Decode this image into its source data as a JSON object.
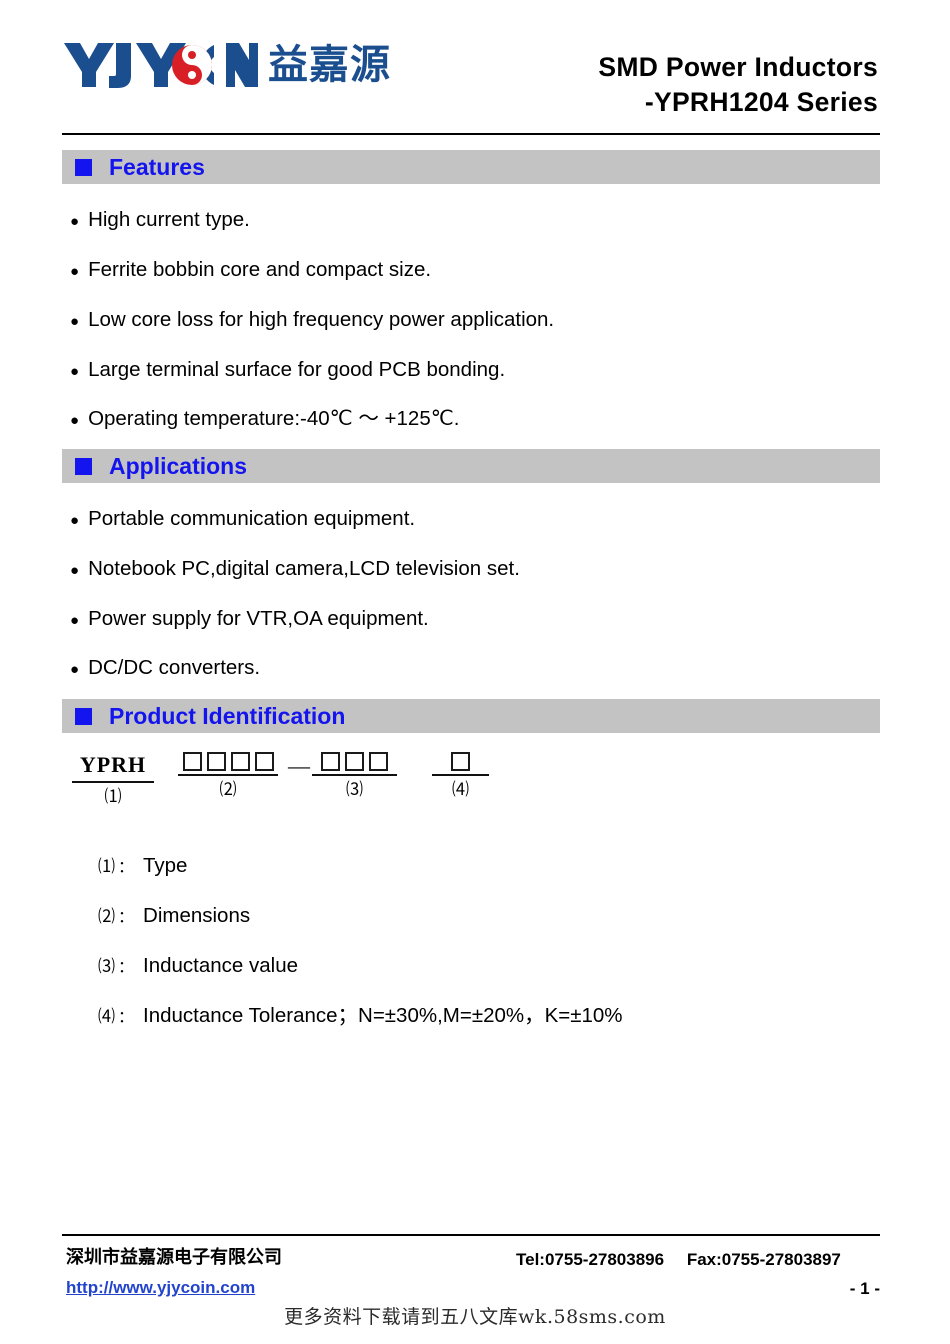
{
  "header": {
    "logo_text_cn": "益嘉源",
    "logo_brand": "YJYCOIN",
    "title_line1": "SMD Power Inductors",
    "title_line2": "-YPRH1204 Series"
  },
  "colors": {
    "section_bar_bg": "#c3c3c3",
    "section_accent": "#1414ee",
    "logo_blue": "#1b4e8f",
    "logo_red": "#d81f26",
    "link_blue": "#2244cc"
  },
  "sections": [
    {
      "title": "Features"
    },
    {
      "title": "Applications"
    },
    {
      "title": "Product Identification"
    }
  ],
  "features": [
    "High current type.",
    "Ferrite bobbin core and compact size.",
    "Low core loss for high frequency power application.",
    "Large terminal surface for good PCB bonding.",
    "Operating temperature:-40℃ ～ +125℃."
  ],
  "applications": [
    "Portable communication equipment.",
    "Notebook PC,digital camera,LCD television set.",
    "Power supply for VTR,OA equipment.",
    "DC/DC converters."
  ],
  "bullet_glyph": "●",
  "part_number": {
    "groups": [
      {
        "code": "YPRH",
        "boxes": 0,
        "label": "⑴"
      },
      {
        "code": "",
        "boxes": 4,
        "label": "⑵"
      },
      {
        "code": "",
        "boxes": 3,
        "label": "⑶"
      },
      {
        "code": "",
        "boxes": 1,
        "label": "⑷"
      }
    ],
    "separator": "—"
  },
  "legend": [
    {
      "num": "⑴",
      "colon": "：",
      "text": "Type"
    },
    {
      "num": "⑵",
      "colon": "：",
      "text": "Dimensions"
    },
    {
      "num": "⑶",
      "colon": "：",
      "text": "Inductance value"
    },
    {
      "num": "⑷",
      "colon": "：",
      "text": "Inductance Tolerance；N=±30%,M=±20%，K=±10%"
    }
  ],
  "footer": {
    "company": "深圳市益嘉源电子有限公司",
    "url": "http://www.yjycoin.com",
    "tel": "Tel:0755-27803896",
    "fax": "Fax:0755-27803897",
    "page": "- 1 -"
  },
  "watermark": "更多资料下载请到五八文库wk.58sms.com"
}
